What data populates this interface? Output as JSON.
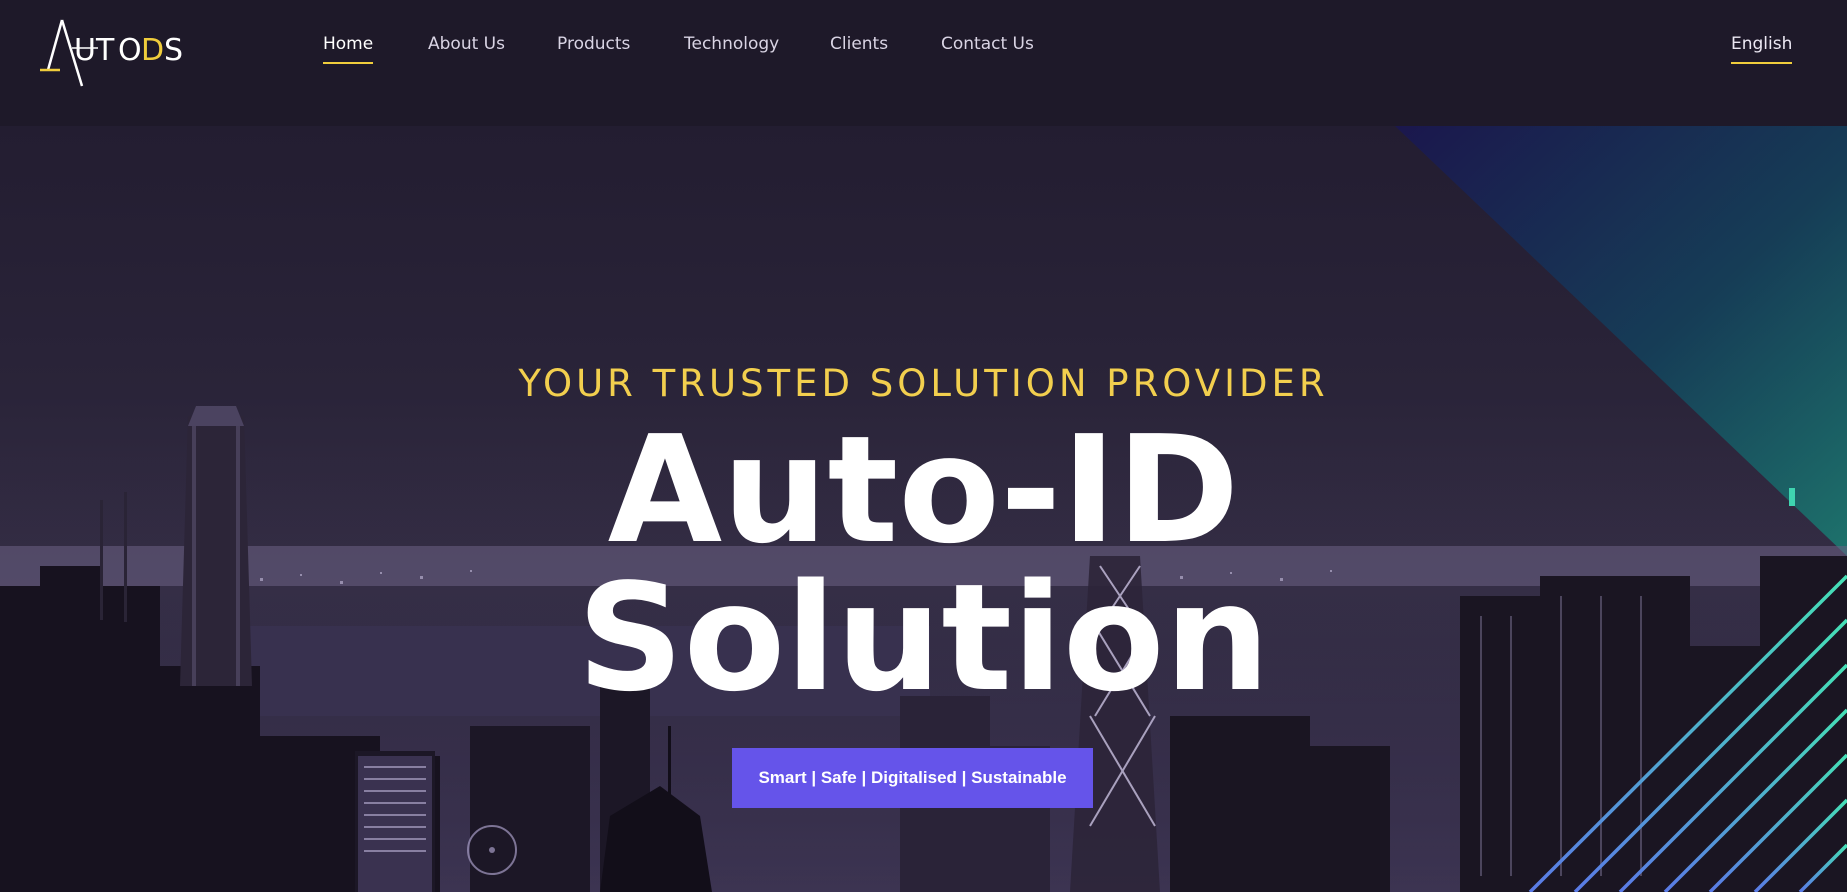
{
  "brand": {
    "logo_text": "AUTODS",
    "accent_color": "#f0cd3c"
  },
  "nav": {
    "items": [
      {
        "label": "Home",
        "active": true
      },
      {
        "label": "About Us",
        "active": false
      },
      {
        "label": "Products",
        "active": false
      },
      {
        "label": "Technology",
        "active": false
      },
      {
        "label": "Clients",
        "active": false
      },
      {
        "label": "Contact Us",
        "active": false
      }
    ],
    "language": "English"
  },
  "hero": {
    "tagline": "YOUR TRUSTED SOLUTION PROVIDER",
    "title_line1": "Auto-ID",
    "title_line2": "Solution",
    "cta_label": "Smart | Safe | Digitalised | Sustainable",
    "cta_color": "#6554ea",
    "tagline_color": "#f2cf4e",
    "background_image": "night city skyline"
  }
}
